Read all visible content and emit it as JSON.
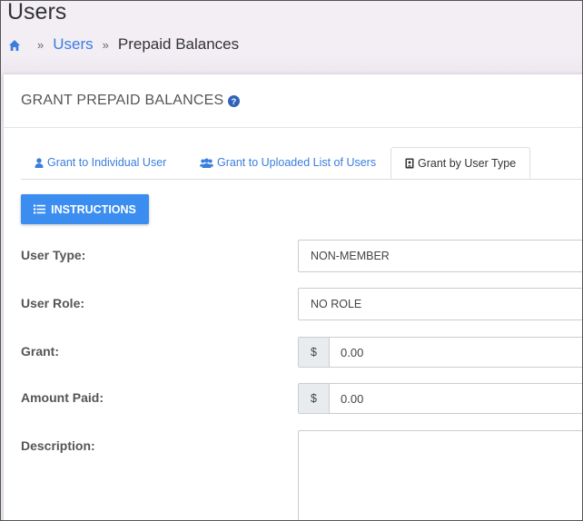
{
  "page": {
    "title": "Users",
    "breadcrumb": {
      "home_icon": "home-icon",
      "items": [
        "Users",
        "Prepaid Balances"
      ],
      "separator": "»"
    }
  },
  "card": {
    "title": "GRANT PREPAID BALANCES",
    "help_icon": "question-circle-icon"
  },
  "tabs": [
    {
      "label": "Grant to Individual User",
      "icon": "user-icon",
      "active": false
    },
    {
      "label": "Grant to Uploaded List of Users",
      "icon": "users-icon",
      "active": false
    },
    {
      "label": "Grant by User Type",
      "icon": "id-badge-icon",
      "active": true
    }
  ],
  "instructions_button": {
    "label": "INSTRUCTIONS",
    "icon": "list-icon"
  },
  "form": {
    "user_type": {
      "label": "User Type:",
      "value": "NON-MEMBER"
    },
    "user_role": {
      "label": "User Role:",
      "value": "NO ROLE"
    },
    "grant": {
      "label": "Grant:",
      "prefix": "$",
      "value": "0.00"
    },
    "amount_paid": {
      "label": "Amount Paid:",
      "prefix": "$",
      "value": "0.00"
    },
    "description": {
      "label": "Description:",
      "value": ""
    }
  },
  "colors": {
    "accent": "#3b7ddd",
    "button": "#3b8ef0",
    "background": "#f2eef4"
  }
}
